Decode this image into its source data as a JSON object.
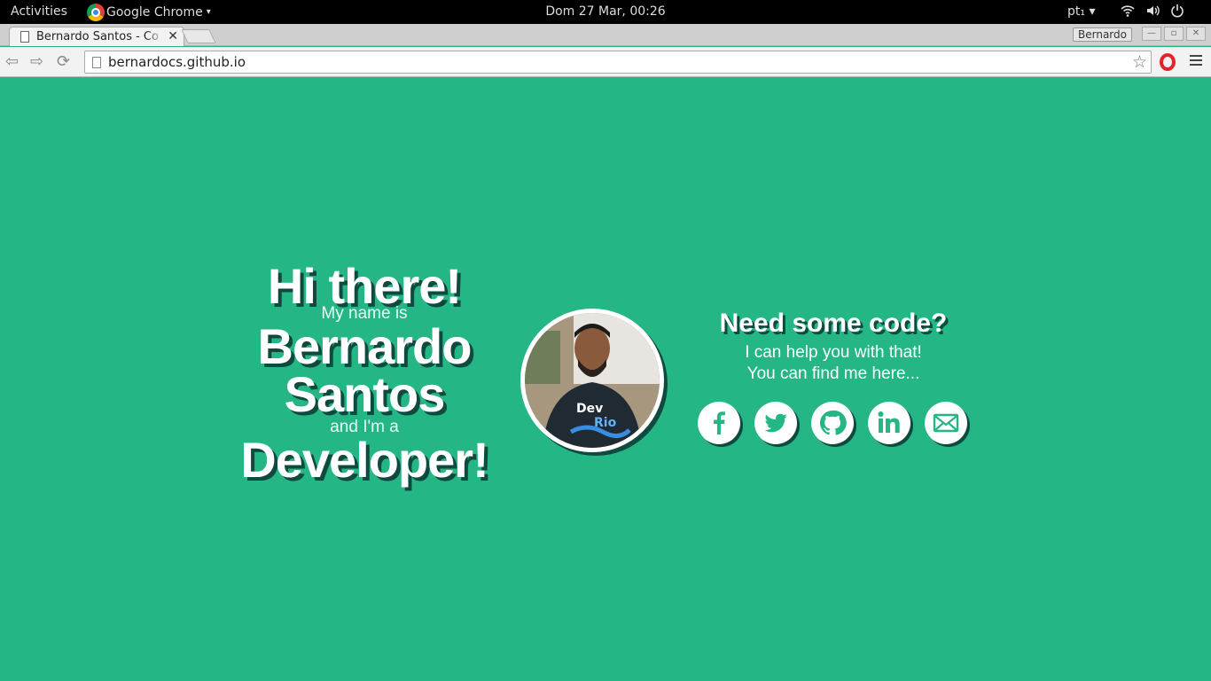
{
  "system_bar": {
    "activities": "Activities",
    "app_name": "Google Chrome",
    "app_arrow": "▾",
    "clock": "Dom 27 Mar, 00:26",
    "keyboard_layout": "pt₁ ▾",
    "icons": [
      "wifi-icon",
      "volume-icon",
      "power-icon"
    ]
  },
  "browser": {
    "tab_title": "Bernardo Santos - Co",
    "tab_close": "✕",
    "profile_name": "Bernardo",
    "url": "bernardocs.github.io",
    "back": "⇦",
    "forward": "⇨",
    "reload": "⟳",
    "star": "☆"
  },
  "intro": {
    "greeting": "Hi there!",
    "name_prefix": "My name is",
    "first_name": "Bernardo",
    "last_name": "Santos",
    "role_prefix": "and I'm a",
    "role": "Developer!"
  },
  "pitch": {
    "heading": "Need some code?",
    "line1": "I can help you with that!",
    "line2": "You can find me here..."
  },
  "social_links": [
    "facebook-icon",
    "twitter-icon",
    "github-icon",
    "linkedin-icon",
    "email-icon"
  ],
  "colors": {
    "background": "#24b684",
    "text_shadow": "#0e4a3f",
    "text": "#ffffff"
  }
}
